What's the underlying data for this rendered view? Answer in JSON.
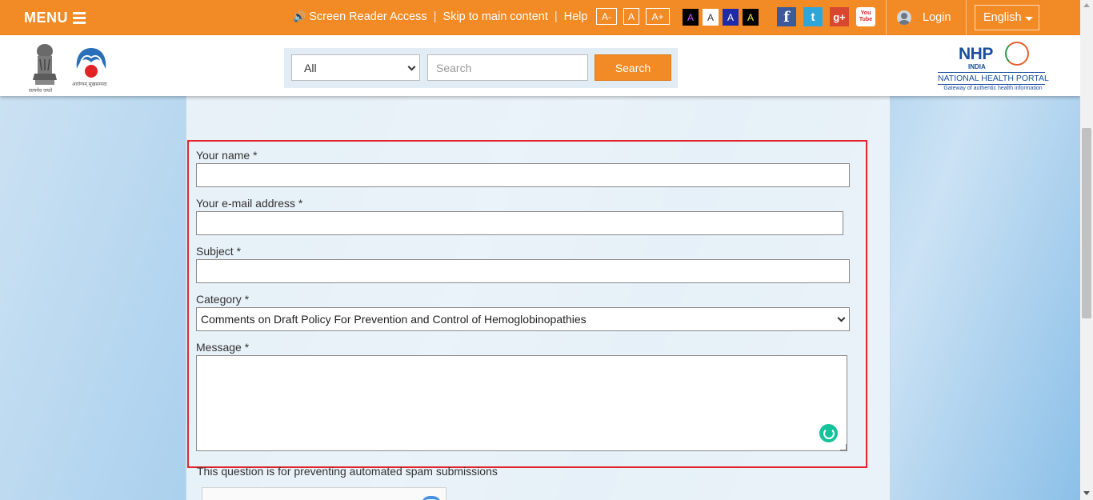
{
  "topbar": {
    "menu_label": "MENU",
    "screen_reader": "Screen Reader Access",
    "skip_main": "Skip to main content",
    "help": "Help",
    "font_sizes": [
      "A-",
      "A",
      "A+"
    ],
    "contrast_labels": [
      "A",
      "A",
      "A",
      "A"
    ],
    "social": {
      "facebook": "f",
      "twitter": "t",
      "googleplus": "g+",
      "youtube": "You Tube"
    },
    "login": "Login",
    "language": "English",
    "colors": {
      "bar": "#f28a25"
    }
  },
  "header": {
    "emblem_caption": "सत्यमेव जयते",
    "mission_caption": "आरोग्यम् सुखसम्पदा",
    "search_scope": "All",
    "search_placeholder": "Search",
    "search_button": "Search",
    "nhp_mark": "NHP",
    "nhp_country": "INDIA",
    "nhp_name": "NATIONAL HEALTH PORTAL",
    "nhp_tagline": "Gateway of authentic health information"
  },
  "form": {
    "name_label": "Your name *",
    "email_label": "Your e-mail address *",
    "subject_label": "Subject *",
    "category_label": "Category *",
    "category_value": "Comments on Draft Policy For Prevention and Control of Hemoglobinopathies",
    "message_label": "Message *",
    "spam_note": "This question is for preventing automated spam submissions",
    "highlight_color": "#e0262b"
  }
}
